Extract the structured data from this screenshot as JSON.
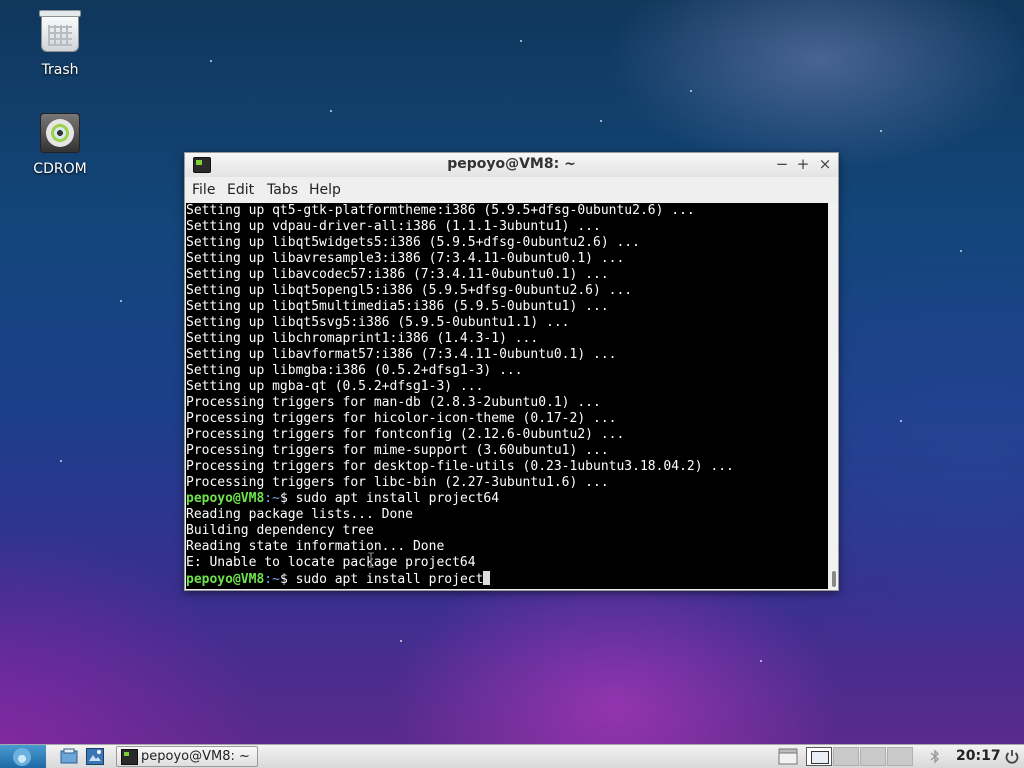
{
  "desktop": {
    "icons": [
      {
        "label": "Trash",
        "icon": "trash-icon"
      },
      {
        "label": "CDROM",
        "icon": "cdrom-icon"
      }
    ]
  },
  "window": {
    "title": "pepoyo@VM8: ~",
    "controls": {
      "minimize": "−",
      "maximize": "+",
      "close": "×"
    },
    "menu": [
      "File",
      "Edit",
      "Tabs",
      "Help"
    ]
  },
  "terminal": {
    "lines": [
      "Setting up qt5-gtk-platformtheme:i386 (5.9.5+dfsg-0ubuntu2.6) ...",
      "Setting up vdpau-driver-all:i386 (1.1.1-3ubuntu1) ...",
      "Setting up libqt5widgets5:i386 (5.9.5+dfsg-0ubuntu2.6) ...",
      "Setting up libavresample3:i386 (7:3.4.11-0ubuntu0.1) ...",
      "Setting up libavcodec57:i386 (7:3.4.11-0ubuntu0.1) ...",
      "Setting up libqt5opengl5:i386 (5.9.5+dfsg-0ubuntu2.6) ...",
      "Setting up libqt5multimedia5:i386 (5.9.5-0ubuntu1) ...",
      "Setting up libqt5svg5:i386 (5.9.5-0ubuntu1.1) ...",
      "Setting up libchromaprint1:i386 (1.4.3-1) ...",
      "Setting up libavformat57:i386 (7:3.4.11-0ubuntu0.1) ...",
      "Setting up libmgba:i386 (0.5.2+dfsg1-3) ...",
      "Setting up mgba-qt (0.5.2+dfsg1-3) ...",
      "Processing triggers for man-db (2.8.3-2ubuntu0.1) ...",
      "Processing triggers for hicolor-icon-theme (0.17-2) ...",
      "Processing triggers for fontconfig (2.12.6-0ubuntu2) ...",
      "Processing triggers for mime-support (3.60ubuntu1) ...",
      "Processing triggers for desktop-file-utils (0.23-1ubuntu3.18.04.2) ...",
      "Processing triggers for libc-bin (2.27-3ubuntu1.6) ..."
    ],
    "prompt_user": "pepoyo@VM8",
    "prompt_path": ":~",
    "prompt_symbol": "$ ",
    "command1": "sudo apt install project64",
    "output": [
      "Reading package lists... Done",
      "Building dependency tree",
      "Reading state information... Done",
      "E: Unable to locate package project64"
    ],
    "command2": "sudo apt install project"
  },
  "taskbar": {
    "task_label": "pepoyo@VM8: ~",
    "clock": "20:17",
    "pager_active": 2
  }
}
